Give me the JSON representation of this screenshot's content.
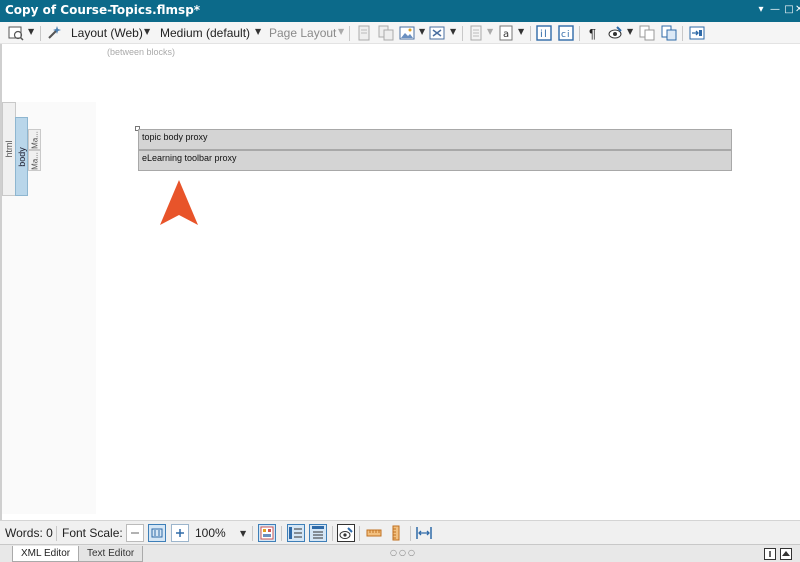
{
  "window": {
    "title": "Copy of Course-Topics.flmsp*",
    "controls": {
      "menu": "▾",
      "minimize": "—",
      "maximize": "□",
      "close": "✕"
    }
  },
  "toolbar": {
    "layout_label": "Layout (Web)",
    "medium_label": "Medium (default)",
    "page_layout_label": "Page Layout",
    "pilcrow": "¶",
    "icons": [
      "preview-icon",
      "magic-wand-icon",
      "insert-image-icon",
      "insert-table-icon",
      "snippet-icon",
      "text-format-icon",
      "condition-tag-icon",
      "variable-icon",
      "pilcrow-icon",
      "show-tags-icon",
      "copy-icon",
      "paste-icon",
      "insert-block-icon"
    ]
  },
  "editor": {
    "blocks_hint": "(between blocks)",
    "structure_tags": {
      "html": "html",
      "body": "body",
      "ma1": "Ma...",
      "ma2": "Ma..."
    },
    "proxies": [
      {
        "label": "topic body proxy"
      },
      {
        "label": "eLearning toolbar proxy"
      }
    ],
    "accent_color": "#e8542a"
  },
  "status": {
    "words": "Words: 0",
    "font_scale_label": "Font Scale:",
    "zoom": "100%"
  },
  "tabs": [
    {
      "label": "XML Editor",
      "active": true
    },
    {
      "label": "Text Editor",
      "active": false
    }
  ],
  "tabbar_dots": "○○○"
}
